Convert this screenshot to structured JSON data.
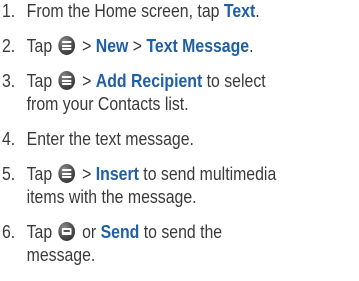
{
  "steps": [
    {
      "num": "1.",
      "parts": [
        "From the Home screen, tap ",
        "Text",
        "."
      ]
    },
    {
      "num": "2.",
      "parts": [
        "Tap ",
        " > ",
        "New",
        " > ",
        "Text Message",
        "."
      ]
    },
    {
      "num": "3.",
      "parts": [
        "Tap ",
        " > ",
        "Add Recipient",
        " to select",
        "from your Contacts list."
      ]
    },
    {
      "num": "4.",
      "parts": [
        "Enter the text message."
      ]
    },
    {
      "num": "5.",
      "parts": [
        "Tap ",
        " > ",
        "Insert",
        " to send multimedia",
        "items with the message."
      ]
    },
    {
      "num": "6.",
      "parts": [
        "Tap ",
        " or ",
        "Send",
        " to send the",
        "message."
      ]
    }
  ],
  "icons": {
    "menu": "menu-icon",
    "send": "send-message-icon"
  },
  "colors": {
    "link": "#1f5fa6",
    "text": "#3a3a3a"
  }
}
